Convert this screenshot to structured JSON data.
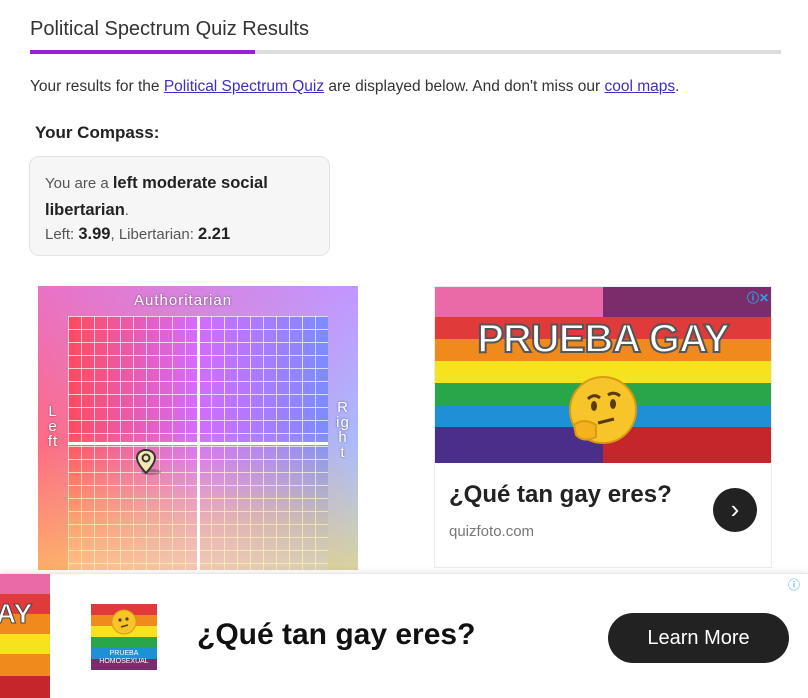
{
  "page": {
    "title": "Political Spectrum Quiz Results",
    "accent_color": "#9b1fd9"
  },
  "intro": {
    "prefix": "Your results for the ",
    "quiz_link": "Political Spectrum Quiz",
    "middle": " are displayed below. And don't miss our ",
    "maps_link": "cool maps",
    "suffix": "."
  },
  "compass": {
    "heading": "Your Compass:",
    "result_prefix": "You are a ",
    "result_value": "left moderate social libertarian",
    "result_suffix": ".",
    "left_label": "Left: ",
    "left_value": "3.99",
    "separator": ", ",
    "lib_label": "Libertarian: ",
    "lib_value": "2.21",
    "axis_top": "Authoritarian",
    "axis_left": "Left",
    "axis_right": "Right"
  },
  "ad_right": {
    "image_headline": "PRUEBA GAY",
    "title": "¿Qué tan gay eres?",
    "domain": "quizfoto.com",
    "arrow": "›",
    "adchoices": "ⓘ✕"
  },
  "bottom_ad": {
    "flag_text": "AY",
    "thumb_label": "PRUEBA HOMOSEXUAL",
    "title": "¿Qué tan gay eres?",
    "button": "Learn More",
    "adchoices": "ⓘ"
  }
}
